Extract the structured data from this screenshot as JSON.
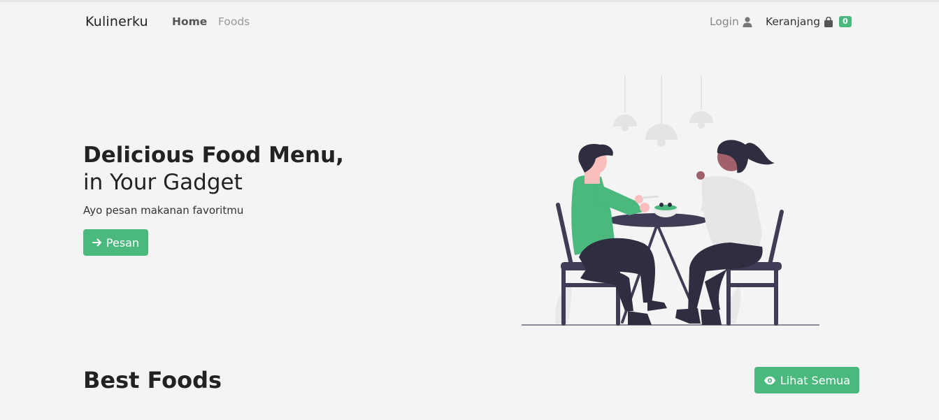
{
  "nav": {
    "brand": "Kulinerku",
    "home": "Home",
    "foods": "Foods",
    "login": "Login",
    "cart": "Keranjang",
    "cart_count": "0"
  },
  "hero": {
    "title_line1": "Delicious Food Menu,",
    "title_line2": "in Your Gadget",
    "subtitle": "Ayo pesan makanan favoritmu",
    "button_label": "Pesan"
  },
  "best": {
    "title_light": "Best",
    "title_bold": "Foods",
    "button_label": "Lihat Semua"
  },
  "colors": {
    "accent": "#4bb87e",
    "background": "#f4f4f4"
  },
  "icons": {
    "login": "user-icon",
    "cart": "shopping-bag-icon",
    "pesan": "arrow-right-icon",
    "lihat": "eye-icon"
  }
}
